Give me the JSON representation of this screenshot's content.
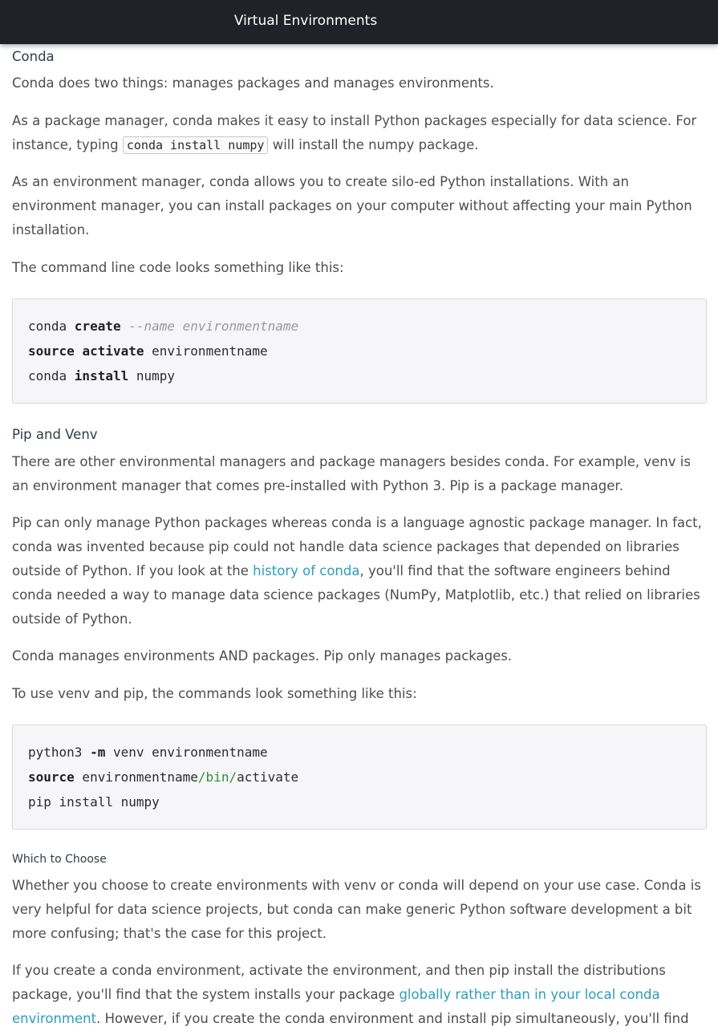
{
  "header": {
    "title": "Virtual Environments"
  },
  "sections": {
    "conda": {
      "heading": "Conda",
      "p1": "Conda does two things: manages packages and manages environments.",
      "p2_before": "As a package manager, conda makes it easy to install Python packages especially for data science. For instance, typing ",
      "p2_code": "conda install numpy",
      "p2_after": " will install the numpy package.",
      "p3": "As an environment manager, conda allows you to create silo-ed Python installations. With an environment manager, you can install packages on your computer without affecting your main Python installation.",
      "p4": "The command line code looks something like this:",
      "code": {
        "l1_a": "conda ",
        "l1_kw": "create",
        "l1_cm": " --name environmentname",
        "l2_kw1": "source",
        "l2_kw2": "activate",
        "l2_rest": " environmentname",
        "l3_a": "conda ",
        "l3_kw": "install",
        "l3_rest": " numpy"
      }
    },
    "pip": {
      "heading": "Pip and Venv",
      "p1": "There are other environmental managers and package managers besides conda. For example, venv is an environment manager that comes pre-installed with Python 3. Pip is a package manager.",
      "p2_before": "Pip can only manage Python packages whereas conda is a language agnostic package manager. In fact, conda was invented because pip could not handle data science packages that depended on libraries outside of Python. If you look at the ",
      "p2_link": "history of conda",
      "p2_after": ", you'll find that the software engineers behind conda needed a way to manage data science packages (NumPy, Matplotlib, etc.) that relied on libraries outside of Python.",
      "p3": "Conda manages environments AND packages. Pip only manages packages.",
      "p4": "To use venv and pip, the commands look something like this:",
      "code": {
        "l1_a": "python3 ",
        "l1_kw": "-m",
        "l1_rest": " venv environmentname",
        "l2_kw": "source",
        "l2_a": " environmentname",
        "l2_gr": "/bin/",
        "l2_b": "activate",
        "l3": "pip install numpy"
      }
    },
    "choose": {
      "heading": "Which to Choose",
      "p1": "Whether you choose to create environments with venv or conda will depend on your use case. Conda is very helpful for data science projects, but conda can make generic Python software development a bit more confusing; that's the case for this project.",
      "p2_before": "If you create a conda environment, activate the environment, and then pip install the distributions package, you'll find that the system installs your package ",
      "p2_link": "globally rather than in your local conda environment",
      "p2_after": ". However, if you create the conda environment and install pip simultaneously, you'll find"
    }
  },
  "colors": {
    "topbar": "#1f2229",
    "link": "#2b9ebb",
    "code_bg": "#f6f6f8"
  }
}
